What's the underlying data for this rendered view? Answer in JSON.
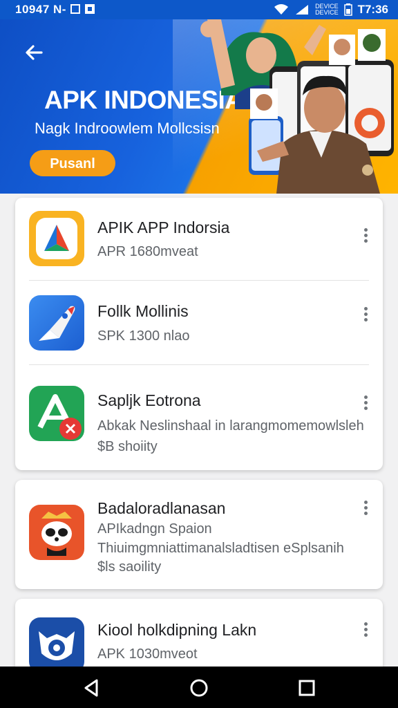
{
  "status_bar": {
    "left_text": "10947 N- ",
    "carrier_line1": "DEVICE",
    "carrier_line2": "DEVICE",
    "time": "T7:36",
    "colors": {
      "background": "#0d58c9"
    }
  },
  "hero": {
    "title": "APK INDONESIA",
    "subtitle": "Nagk Indroowlem Mollcsisn",
    "button_label": "Pusanl",
    "colors": {
      "blue": "#1762dd",
      "orange": "#ffb400",
      "button": "#f59d16"
    }
  },
  "apps": [
    {
      "name": "APIK APP Indorsia",
      "meta": "APR 1680mveat",
      "icon": "apik-logo-icon"
    },
    {
      "name": "Follk Mollinis",
      "meta": "SPK 1300 nlao",
      "icon": "rocket-icon"
    },
    {
      "name": "Sapljk Eotrona",
      "desc_line1": "Abkak Neslinshaal in larangmomemowlsleh",
      "desc_line2": "$B shoiity",
      "icon": "green-a-icon"
    },
    {
      "name": "Badaloradlanasan",
      "desc_line1": "APIkadngn Spaion",
      "desc_line2": "Thiuimgmniattimanalsladtisen eSplsanih",
      "desc_line3": "$ls saoility",
      "icon": "panda-mascot-icon"
    },
    {
      "name": "Kiool holkdipning Lakn",
      "meta": "APK 1030mveot",
      "icon": "fox-icon"
    }
  ]
}
